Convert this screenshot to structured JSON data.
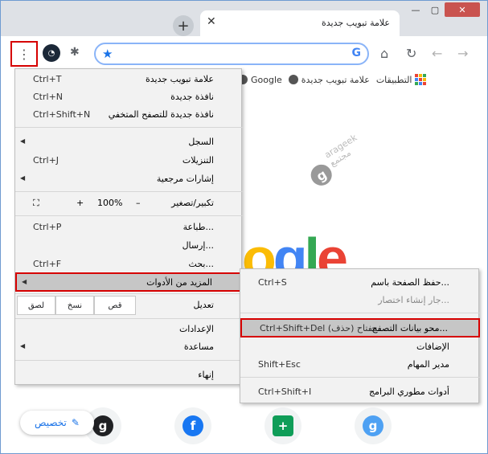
{
  "tab": {
    "title": "علامة تبويب جديدة",
    "close_label": "✕",
    "new_tab_label": "+"
  },
  "window": {
    "min": "—",
    "max": "▢",
    "close": "✕"
  },
  "toolbar": {
    "menu_icon": "⋮",
    "extensions_icon": "puzzle",
    "star_icon": "★",
    "google_icon": "G",
    "home_icon": "⌂",
    "reload_icon": "↻",
    "back_icon": "←",
    "forward_icon": "→"
  },
  "bookmarks": [
    {
      "label": "Google"
    },
    {
      "label": "علامة تبويب جديدة"
    },
    {
      "label": "التطبيقات"
    }
  ],
  "watermark": {
    "line1": "arageek",
    "line2": "مجتمع",
    "badge": "g"
  },
  "google_logo": {
    "text": "ogle"
  },
  "shortcuts": [
    {
      "letter": "g",
      "color": "#202124"
    },
    {
      "letter": "f",
      "color": "#1877f2"
    },
    {
      "letter": "+",
      "color": "#0f9d58"
    },
    {
      "letter": "g",
      "color": "#4ea1f3"
    }
  ],
  "customize": {
    "label": "تخصيص",
    "icon": "✎"
  },
  "menu": {
    "new_tab": {
      "label": "علامة تبويب جديدة",
      "shortcut": "Ctrl+T"
    },
    "new_window": {
      "label": "نافذة جديدة",
      "shortcut": "Ctrl+N"
    },
    "incognito": {
      "label": "نافذة جديدة للتصفح المتخفي",
      "shortcut": "Ctrl+Shift+N"
    },
    "history": {
      "label": "السجل"
    },
    "downloads": {
      "label": "التنزيلات",
      "shortcut": "Ctrl+J"
    },
    "bookmarks": {
      "label": "إشارات مرجعية"
    },
    "zoom": {
      "label": "تكبير/تصغير",
      "minus": "–",
      "value": "100%",
      "plus": "+",
      "fullscreen": "⛶"
    },
    "print": {
      "label": "طباعة...",
      "shortcut": "Ctrl+P"
    },
    "cast": {
      "label": "إرسال..."
    },
    "find": {
      "label": "بحث...",
      "shortcut": "Ctrl+F"
    },
    "more_tools": {
      "label": "المزيد من الأدوات"
    },
    "edit": {
      "label": "تعديل",
      "cut": "قص",
      "copy": "نسخ",
      "paste": "لصق"
    },
    "settings": {
      "label": "الإعدادات"
    },
    "help": {
      "label": "مساعدة"
    },
    "exit": {
      "label": "إنهاء"
    }
  },
  "submenu": {
    "save_page": {
      "label": "حفظ الصفحة باسم...",
      "shortcut": "Ctrl+S"
    },
    "create_shortcut": {
      "label": "جار إنشاء اختصار..."
    },
    "clear_data": {
      "label": "محو بيانات التصفح...",
      "shortcut": "Ctrl+Shift+Del مفتاح (حذف)"
    },
    "extensions": {
      "label": "الإضافات"
    },
    "task_manager": {
      "label": "مدير المهام",
      "shortcut": "Shift+Esc"
    },
    "dev_tools": {
      "label": "أدوات مطوري البرامج",
      "shortcut": "Ctrl+Shift+I"
    }
  }
}
